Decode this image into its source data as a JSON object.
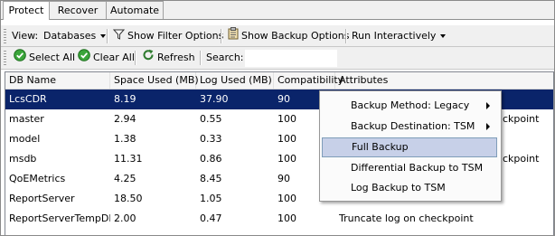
{
  "tabs": [
    {
      "label": "Protect",
      "active": true
    },
    {
      "label": "Recover",
      "active": false
    },
    {
      "label": "Automate",
      "active": false
    }
  ],
  "toolbar1": {
    "view_label": "View:",
    "view_value": "Databases",
    "filter_label": "Show Filter Options",
    "backup_label": "Show Backup Options",
    "run_label": "Run Interactively"
  },
  "toolbar2": {
    "select_all": "Select All",
    "clear_all": "Clear All",
    "refresh": "Refresh",
    "search_label": "Search:",
    "search_value": ""
  },
  "table": {
    "columns": [
      "DB Name",
      "Space Used (MB)",
      "Log Used (MB)",
      "Compatibility",
      "Attributes"
    ],
    "rows": [
      {
        "name": "LcsCDR",
        "space": "8.19",
        "log": "37.90",
        "compat": "90",
        "attr": ""
      },
      {
        "name": "master",
        "space": "2.94",
        "log": "0.55",
        "compat": "100",
        "attr": "ckpoint"
      },
      {
        "name": "model",
        "space": "1.38",
        "log": "0.33",
        "compat": "100",
        "attr": ""
      },
      {
        "name": "msdb",
        "space": "11.31",
        "log": "0.86",
        "compat": "100",
        "attr": "ckpoint"
      },
      {
        "name": "QoEMetrics",
        "space": "4.25",
        "log": "8.45",
        "compat": "90",
        "attr": ""
      },
      {
        "name": "ReportServer",
        "space": "18.50",
        "log": "1.05",
        "compat": "100",
        "attr": ""
      },
      {
        "name": "ReportServerTempDB",
        "space": "2.00",
        "log": "0.47",
        "compat": "100",
        "attr": "Truncate log on checkpoint"
      }
    ],
    "selected_row": 0
  },
  "context_menu": {
    "items": [
      {
        "label": "Backup Method: Legacy",
        "submenu": true
      },
      {
        "label": "Backup Destination: TSM",
        "submenu": true
      },
      {
        "label": "Full Backup",
        "submenu": false,
        "highlighted": true
      },
      {
        "label": "Differential Backup to TSM",
        "submenu": false
      },
      {
        "label": "Log Backup to TSM",
        "submenu": false
      }
    ]
  },
  "colors": {
    "selection": "#0a246a",
    "menu_highlight": "#c7d0e8",
    "toolbar_bg": "#f0f0f0"
  }
}
